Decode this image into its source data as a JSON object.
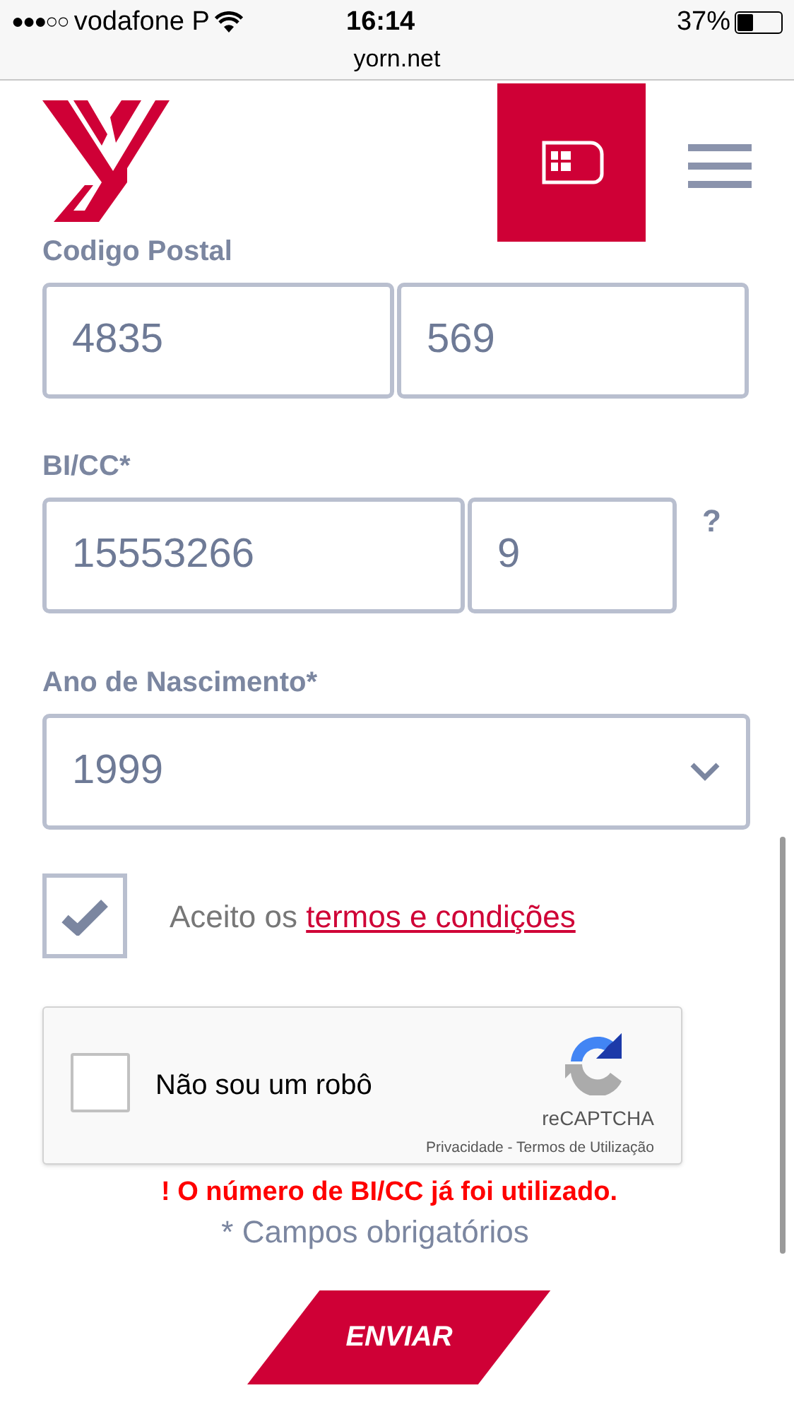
{
  "status_bar": {
    "signal_dots": "●●●○○",
    "carrier": "vodafone P",
    "time": "16:14",
    "battery": "37%"
  },
  "address_bar": {
    "url": "yorn.net"
  },
  "form": {
    "sections": [
      {
        "label": "Codigo Postal",
        "fields": [
          {
            "value": "4835",
            "kind": "text"
          },
          {
            "value": "569",
            "kind": "text"
          }
        ]
      },
      {
        "label": "BI/CC*",
        "fields": [
          {
            "value": "15553266",
            "kind": "text"
          },
          {
            "value": "9",
            "kind": "text"
          }
        ],
        "help": "?"
      },
      {
        "label": "Ano de Nascimento*",
        "fields": [
          {
            "value": "1999",
            "kind": "select"
          }
        ]
      }
    ],
    "terms": {
      "checked": true,
      "text": "Aceito os ",
      "link": "termos e condições"
    },
    "captcha": {
      "checked": false,
      "label": "Não sou um robô",
      "brand": "reCAPTCHA",
      "footer": "Privacidade - Termos de Utilização"
    },
    "error": "! O número de BI/CC já foi utilizado.",
    "required_note": "* Campos obrigatórios",
    "submit": "ENVIAR"
  }
}
